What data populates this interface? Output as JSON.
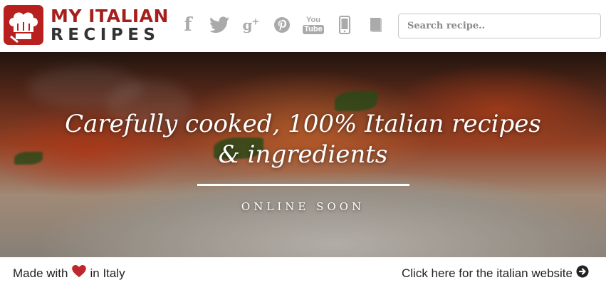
{
  "header": {
    "logo": {
      "line1": "MY ITALIAN",
      "line2": "RECIPES"
    },
    "social": [
      {
        "name": "facebook",
        "icon": "facebook-icon"
      },
      {
        "name": "twitter",
        "icon": "twitter-icon"
      },
      {
        "name": "google-plus",
        "icon": "google-plus-icon"
      },
      {
        "name": "pinterest",
        "icon": "pinterest-icon"
      },
      {
        "name": "youtube",
        "icon": "youtube-icon",
        "you": "You",
        "tube": "Tube"
      },
      {
        "name": "mobile",
        "icon": "mobile-phone-icon"
      },
      {
        "name": "book",
        "icon": "book-icon"
      }
    ],
    "search": {
      "placeholder": "Search recipe..",
      "value": ""
    }
  },
  "hero": {
    "title_line1": "Carefully cooked, 100% Italian recipes",
    "title_line2": "& ingredients",
    "subtitle": "ONLINE SOON"
  },
  "footer": {
    "made_prefix": "Made with",
    "made_suffix": "in Italy",
    "heart_icon": "heart-icon",
    "italian_link": "Click here for the italian website",
    "arrow_icon": "arrow-circle-right-icon"
  },
  "colors": {
    "brand_red": "#a51f1d",
    "logo_dark": "#333333",
    "icon_gray": "#aaaaaa",
    "heart_red": "#c0272d"
  }
}
